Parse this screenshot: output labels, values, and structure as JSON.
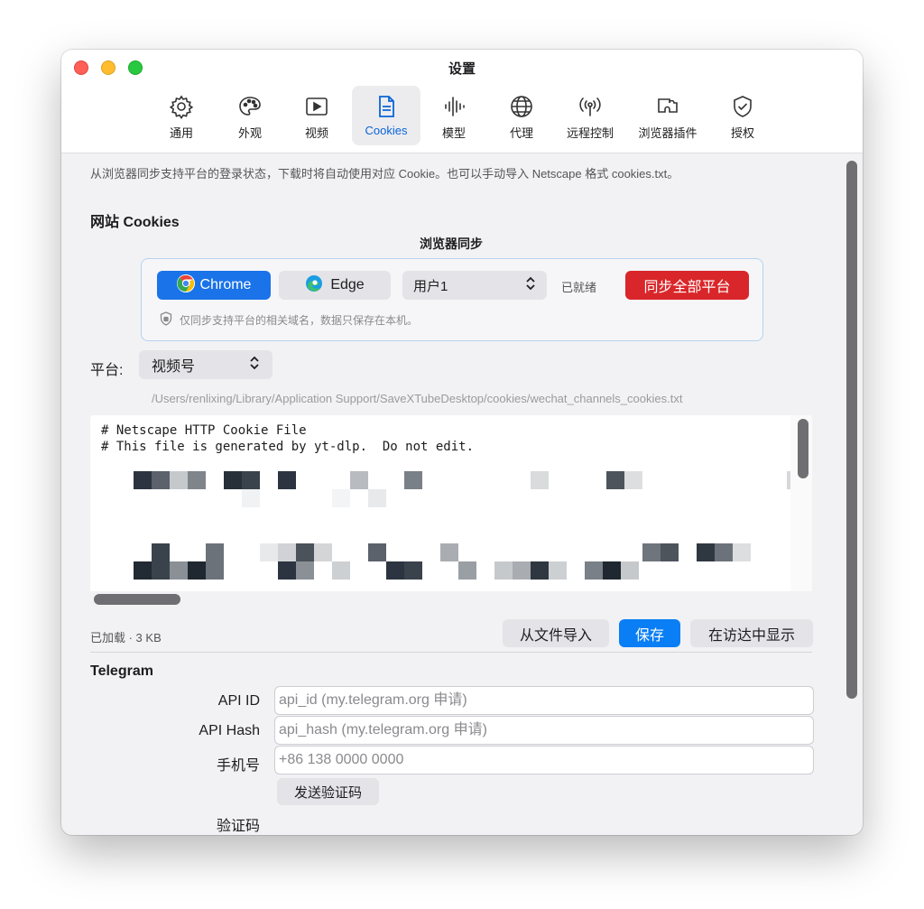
{
  "window": {
    "title": "设置"
  },
  "tabs": [
    {
      "label": "通用",
      "icon": "gear-icon"
    },
    {
      "label": "外观",
      "icon": "palette-icon"
    },
    {
      "label": "视频",
      "icon": "play-icon"
    },
    {
      "label": "Cookies",
      "icon": "document-icon",
      "active": true
    },
    {
      "label": "模型",
      "icon": "waveform-icon"
    },
    {
      "label": "代理",
      "icon": "globe-icon"
    },
    {
      "label": "远程控制",
      "icon": "antenna-icon"
    },
    {
      "label": "浏览器插件",
      "icon": "puzzle-icon"
    },
    {
      "label": "授权",
      "icon": "shield-check-icon"
    }
  ],
  "intro": "从浏览器同步支持平台的登录状态，下载时将自动使用对应 Cookie。也可以手动导入 Netscape 格式 cookies.txt。",
  "cookies_section": {
    "title": "网站 Cookies",
    "sync_heading": "浏览器同步",
    "chrome_label": "Chrome",
    "edge_label": "Edge",
    "user_select": "用户1",
    "status": "已就绪",
    "sync_all_label": "同步全部平台",
    "note": "仅同步支持平台的相关域名，数据只保存在本机。"
  },
  "platform": {
    "label": "平台:",
    "selected": "视频号",
    "path": "/Users/renlixing/Library/Application Support/SaveXTubeDesktop/cookies/wechat_channels_cookies.txt"
  },
  "editor": {
    "line1": "# Netscape HTTP Cookie File",
    "line2": "# This file is generated by yt-dlp.  Do not edit."
  },
  "footer": {
    "loaded": "已加载 · 3 KB",
    "import_label": "从文件导入",
    "save_label": "保存",
    "finder_label": "在访达中显示"
  },
  "telegram": {
    "title": "Telegram",
    "api_id_label": "API ID",
    "api_id_placeholder": "api_id (my.telegram.org 申请)",
    "api_hash_label": "API Hash",
    "api_hash_placeholder": "api_hash (my.telegram.org 申请)",
    "phone_label": "手机号",
    "phone_placeholder": "+86 138 0000 0000",
    "send_code_label": "发送验证码",
    "code_label": "验证码"
  },
  "colors": {
    "accent": "#0a7ef5",
    "chrome_button": "#1a73e8",
    "danger": "#d9262a"
  }
}
